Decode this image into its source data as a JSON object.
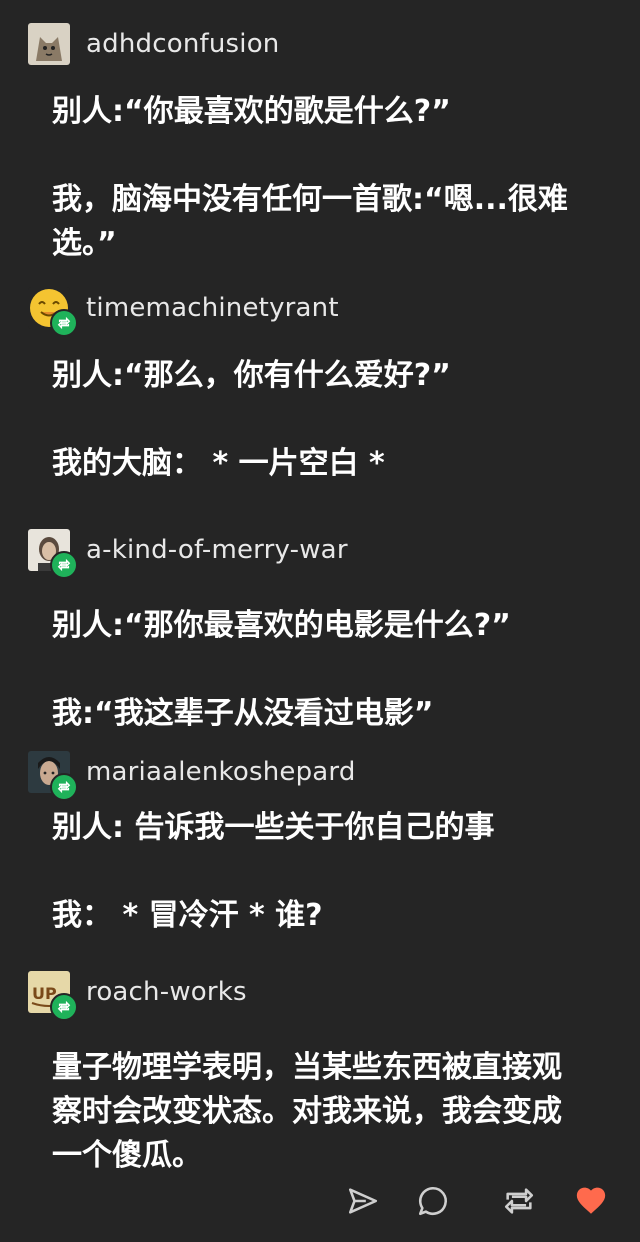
{
  "posts": [
    {
      "username": "adhdconfusion",
      "avatar": "fox-avatar",
      "reblogged": false,
      "lines": [
        "别人:“你最喜欢的歌是什么?”",
        "",
        "我，脑海中没有任何一首歌:“嗯...很难",
        "选。”"
      ]
    },
    {
      "username": "timemachinetyrant",
      "avatar": "smiling-face-avatar",
      "reblogged": true,
      "lines": [
        "别人:“那么，你有什么爱好?”",
        "",
        "我的大脑： * 一片空白 *"
      ]
    },
    {
      "username": "a-kind-of-merry-war",
      "avatar": "portrait-avatar",
      "reblogged": true,
      "lines": [
        "别人:“那你最喜欢的电影是什么?”",
        "",
        "我:“我这辈子从没看过电影”"
      ]
    },
    {
      "username": "mariaalenkoshepard",
      "avatar": "dark-portrait-avatar",
      "reblogged": true,
      "lines": [
        "别人: 告诉我一些关于你自己的事",
        "",
        "我： * 冒冷汗 * 谁?"
      ]
    },
    {
      "username": "roach-works",
      "avatar": "sign-avatar",
      "reblogged": true,
      "lines": [
        "量子物理学表明，当某些东西被直接观",
        "察时会改变状态。对我来说，我会变成",
        "一个傻瓜。"
      ]
    }
  ],
  "actions": [
    {
      "icon": "share-icon"
    },
    {
      "icon": "comment-icon"
    },
    {
      "icon": "reblog-icon"
    },
    {
      "icon": "heart-icon",
      "color": "#ff6a4d"
    }
  ],
  "colors": {
    "background": "#252525",
    "reblog_green": "#1fb25a",
    "heart": "#ff6a4d"
  }
}
